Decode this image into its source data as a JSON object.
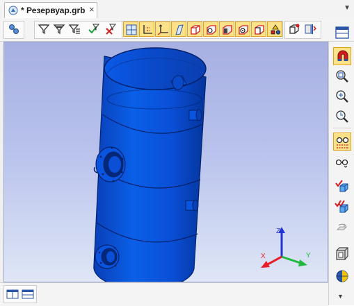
{
  "tab": {
    "title": "* Резервуар.grb",
    "close_glyph": "×",
    "menu_glyph": "▼"
  },
  "toolbar": {
    "buttons": [
      "object-tree-icon",
      "filter-icon",
      "filter-settings-icon",
      "filter-list-icon",
      "select-filter-icon",
      "deselect-filter-icon",
      "view-front-icon",
      "view-2d-axes-icon",
      "view-3d-axes-icon",
      "view-plane-icon",
      "cube-red-icon",
      "cube-gear-icon",
      "cube-fill-icon",
      "cube-gear-2-icon",
      "cube-outline-icon",
      "shapes-icon",
      "cube-light-icon",
      "screenshot-icon"
    ],
    "active": [
      "view-front-icon",
      "view-2d-axes-icon",
      "view-3d-axes-icon",
      "view-plane-icon",
      "cube-red-icon",
      "cube-gear-icon",
      "cube-fill-icon",
      "cube-gear-2-icon",
      "cube-outline-icon",
      "shapes-icon"
    ]
  },
  "right_toolbar": {
    "buttons": [
      "window-layout-icon",
      "magnet-icon",
      "zoom-window-icon",
      "zoom-fit-icon",
      "zoom-previous-icon",
      "glasses-grid-icon",
      "glasses-icon",
      "check-cube-icon",
      "check-cube-multi-icon",
      "rotate-icon",
      "box-view-icon",
      "globe-light-icon"
    ],
    "scroll_down_glyph": "▼"
  },
  "triad": {
    "x_label": "X",
    "y_label": "Y",
    "z_label": "Z",
    "x_color": "#e8202a",
    "y_color": "#1fb93c",
    "z_color": "#2233d8"
  },
  "colors": {
    "model_blue": "#0a4fd6",
    "model_dark": "#0335a0",
    "highlight": "#fde28a"
  }
}
